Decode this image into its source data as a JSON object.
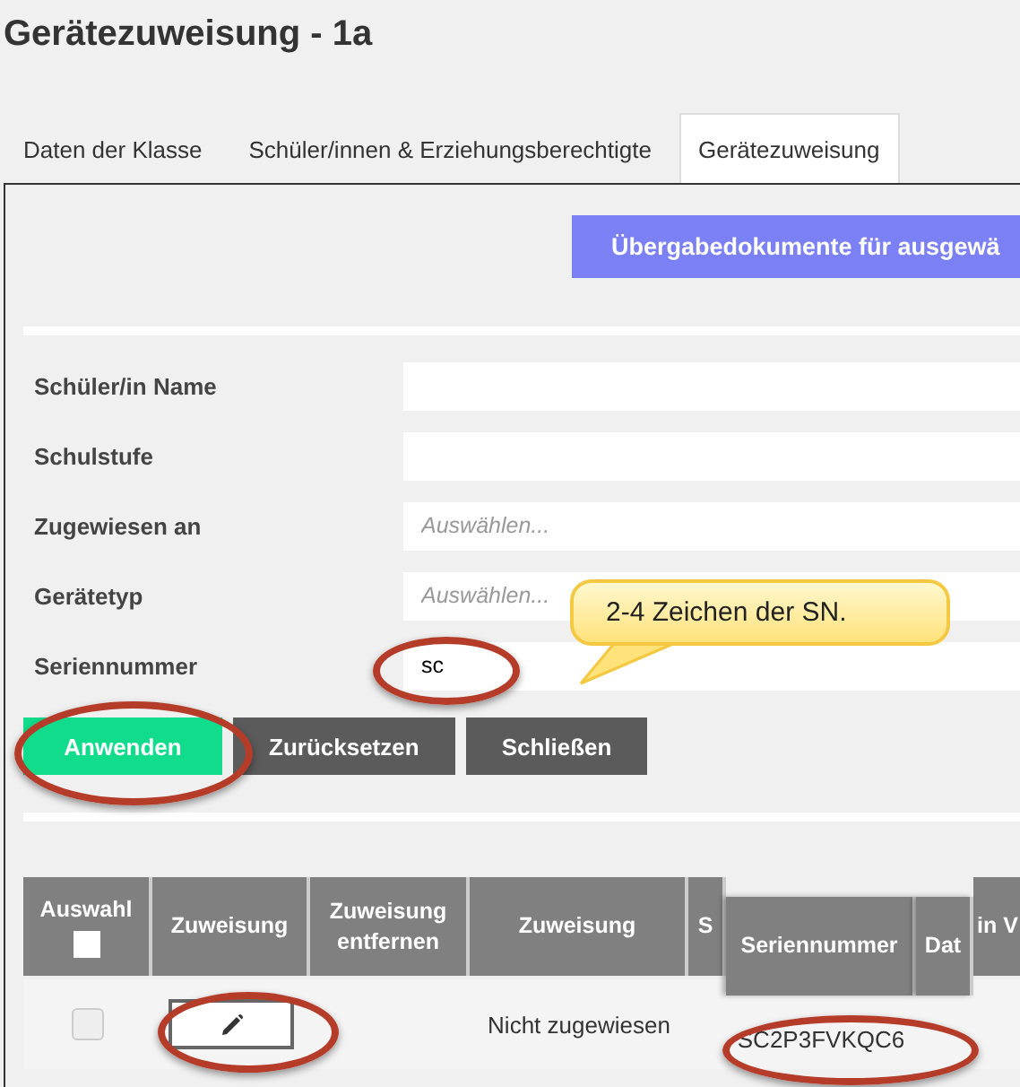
{
  "page": {
    "title": "Gerätezuweisung - 1a"
  },
  "tabs": [
    {
      "label": "Daten der Klasse",
      "selected": false
    },
    {
      "label": "Schüler/innen & Erziehungsberechtigte",
      "selected": false
    },
    {
      "label": "Gerätezuweisung",
      "selected": true
    }
  ],
  "action_button": {
    "label": "Übergabedokumente für ausgewä"
  },
  "filters": [
    {
      "label": "Schüler/in Name"
    },
    {
      "label": "Schulstufe"
    },
    {
      "label": "Zugewiesen an",
      "placeholder": "Auswählen..."
    },
    {
      "label": "Gerätetyp",
      "placeholder": "Auswählen..."
    },
    {
      "label": "Seriennummer",
      "value": "sc"
    }
  ],
  "buttons": [
    {
      "label": "Anwenden",
      "kind": "primary"
    },
    {
      "label": "Zurücksetzen",
      "kind": "secondary"
    },
    {
      "label": "Schließen",
      "kind": "secondary"
    }
  ],
  "table": {
    "columns": [
      {
        "label": "Auswahl",
        "kind": "select",
        "checked": false
      },
      {
        "label": "Zuweisung",
        "kind": "plain"
      },
      {
        "label": "Zuweisung entfernen",
        "kind": "plain"
      },
      {
        "label": "Zuweisung",
        "kind": "plain"
      },
      {
        "label": "S",
        "kind": "plain"
      },
      {
        "label": "Seriennummer",
        "kind": "floating"
      },
      {
        "label": "Dat",
        "kind": "floating"
      },
      {
        "label": "in V",
        "kind": "plain"
      }
    ],
    "rows": [
      {
        "cells": [
          {
            "kind": "checkbox",
            "checked": false,
            "disabled": true
          },
          {
            "kind": "edit"
          },
          {
            "kind": "empty"
          },
          {
            "kind": "text",
            "text": "Nicht zugewiesen"
          },
          {
            "kind": "empty"
          },
          {
            "kind": "text",
            "text": "SC2P3FVKQC6"
          },
          {
            "kind": "empty"
          },
          {
            "kind": "empty"
          }
        ]
      }
    ]
  },
  "annotation": {
    "callout": "2-4 Zeichen der SN."
  }
}
